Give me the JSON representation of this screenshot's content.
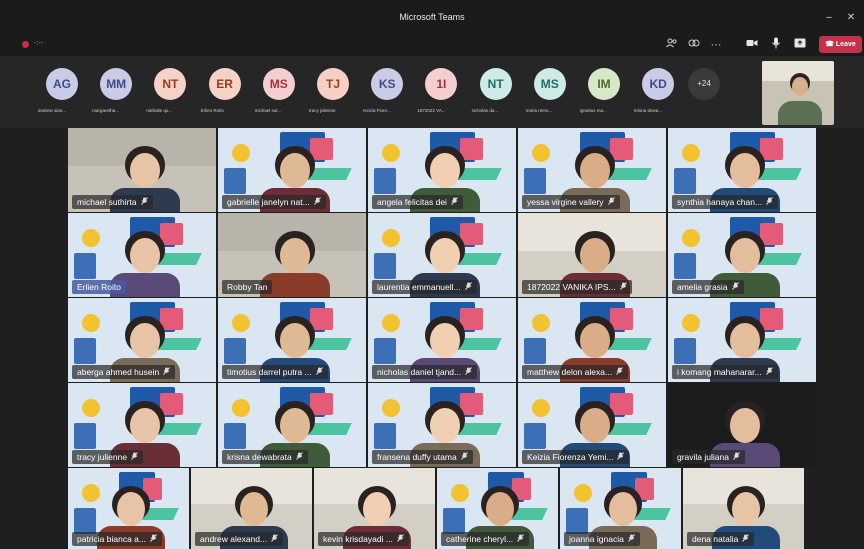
{
  "window": {
    "title": "Microsoft Teams",
    "min": "–",
    "close": "✕"
  },
  "toolbar": {
    "rec_time": "-:--",
    "icons": [
      "people-icon",
      "share-icon",
      "more-icon",
      "camera-icon",
      "mic-icon",
      "share-tray-icon"
    ],
    "more_label": "···",
    "leave_label": "Leave"
  },
  "strip": {
    "participants": [
      {
        "initials": "AG",
        "name": "andrew alos...",
        "bg": "#c9cbe7",
        "fg": "#3f4a8a"
      },
      {
        "initials": "MM",
        "name": "margaretha...",
        "bg": "#c9cbe7",
        "fg": "#3f4a8a"
      },
      {
        "initials": "NT",
        "name": "nathalie qu...",
        "bg": "#f4d3c6",
        "fg": "#9b3b1e"
      },
      {
        "initials": "ER",
        "name": "Erlien Roito",
        "bg": "#f4d3c6",
        "fg": "#9b3b1e"
      },
      {
        "initials": "MS",
        "name": "michael sut...",
        "bg": "#f5cfcf",
        "fg": "#a2333b"
      },
      {
        "initials": "TJ",
        "name": "tracy julienne",
        "bg": "#f7d0c4",
        "fg": "#a23d1f"
      },
      {
        "initials": "KS",
        "name": "Keizia Fiore...",
        "bg": "#c9cbe7",
        "fg": "#3f4a8a"
      },
      {
        "initials": "1I",
        "name": "1872022 VA...",
        "bg": "#f5cfcf",
        "fg": "#a2333b"
      },
      {
        "initials": "NT",
        "name": "nicholas da...",
        "bg": "#cdeae6",
        "fg": "#1f6e67"
      },
      {
        "initials": "MS",
        "name": "maria retno...",
        "bg": "#cdeae6",
        "fg": "#1f6e67"
      },
      {
        "initials": "IM",
        "name": "ignatius ma...",
        "bg": "#d7e8c8",
        "fg": "#4b6b2c"
      },
      {
        "initials": "KD",
        "name": "krisna dewa...",
        "bg": "#c9cbe7",
        "fg": "#3f4a8a"
      }
    ],
    "more_count": "+24"
  },
  "tiles": [
    {
      "name": "michael suthirta",
      "kind": "cam"
    },
    {
      "name": "gabrielle janelyn nat...",
      "kind": "bg"
    },
    {
      "name": "angela felicitas dei",
      "kind": "bg"
    },
    {
      "name": "yessa virgine vallery",
      "kind": "bg"
    },
    {
      "name": "synthia hanaya chan...",
      "kind": "bg"
    },
    {
      "name": "Erlien Roito",
      "kind": "bg",
      "highlight": true
    },
    {
      "name": "Robby Tan",
      "kind": "cam"
    },
    {
      "name": "laurentia emmanuell...",
      "kind": "bg"
    },
    {
      "name": "1872022 VANIKA IPS...",
      "kind": "cam2"
    },
    {
      "name": "amelia grasia",
      "kind": "bg"
    },
    {
      "name": "aberga ahmed husein",
      "kind": "bg"
    },
    {
      "name": "timotius darrel putra ...",
      "kind": "bg"
    },
    {
      "name": "nicholas daniel tjand...",
      "kind": "bg"
    },
    {
      "name": "matthew delon alexa...",
      "kind": "bg"
    },
    {
      "name": "i komang mahanarar...",
      "kind": "bg"
    },
    {
      "name": "tracy julienne",
      "kind": "bg"
    },
    {
      "name": "krisna dewabrata",
      "kind": "bg"
    },
    {
      "name": "fransena duffy utama",
      "kind": "bg"
    },
    {
      "name": "Keizia Fiorenza Yemi...",
      "kind": "bg"
    },
    {
      "name": "gravila juliana",
      "kind": "dark"
    },
    {
      "name": "patricia bianca a...",
      "kind": "bg"
    },
    {
      "name": "andrew alexand...",
      "kind": "cam2"
    },
    {
      "name": "kevin krisdayadi ...",
      "kind": "cam2"
    },
    {
      "name": "catherine cheryl...",
      "kind": "bg"
    },
    {
      "name": "joanna ignacia",
      "kind": "bg"
    },
    {
      "name": "dena natalia",
      "kind": "cam2"
    }
  ],
  "mic_glyph": "🎤︎"
}
